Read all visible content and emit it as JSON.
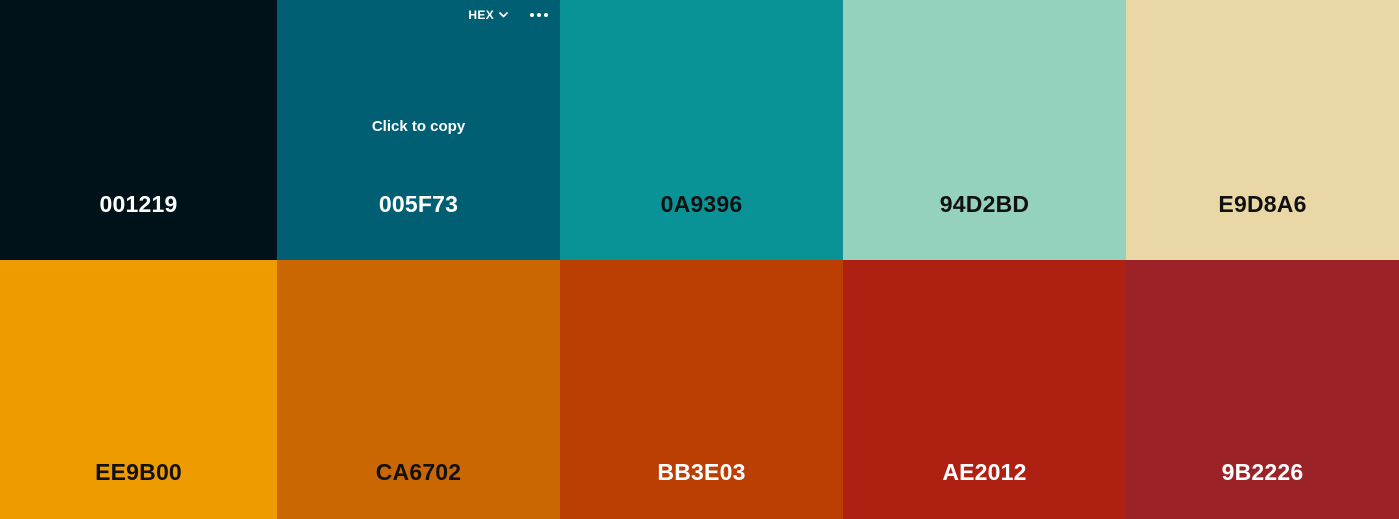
{
  "toolbar": {
    "format_label": "HEX",
    "hint": "Click to copy"
  },
  "swatches": [
    {
      "hex": "001219",
      "color": "#001219",
      "text_tone": "light"
    },
    {
      "hex": "005F73",
      "color": "#005F73",
      "text_tone": "light"
    },
    {
      "hex": "0A9396",
      "color": "#0A9396",
      "text_tone": "dark"
    },
    {
      "hex": "94D2BD",
      "color": "#94D2BD",
      "text_tone": "dark"
    },
    {
      "hex": "E9D8A6",
      "color": "#E9D8A6",
      "text_tone": "dark"
    },
    {
      "hex": "EE9B00",
      "color": "#EE9B00",
      "text_tone": "dark"
    },
    {
      "hex": "CA6702",
      "color": "#CA6702",
      "text_tone": "dark"
    },
    {
      "hex": "BB3E03",
      "color": "#BB3E03",
      "text_tone": "light"
    },
    {
      "hex": "AE2012",
      "color": "#AE2012",
      "text_tone": "light"
    },
    {
      "hex": "9B2226",
      "color": "#9B2226",
      "text_tone": "light"
    }
  ]
}
